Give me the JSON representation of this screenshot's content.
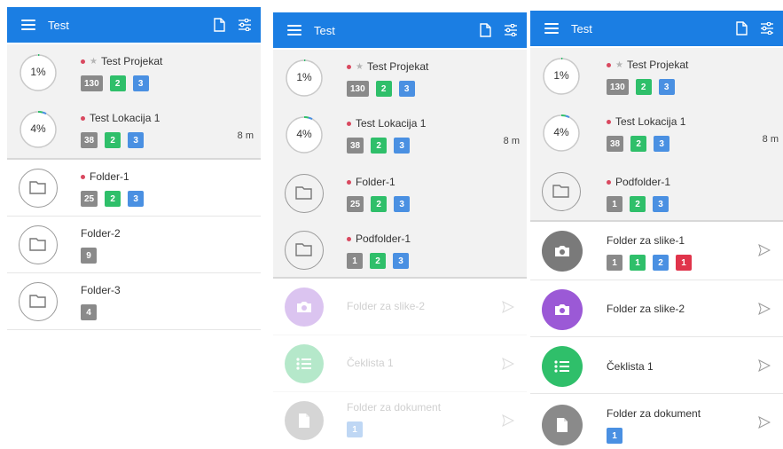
{
  "app": {
    "title": "Test"
  },
  "panels": [
    {
      "projects": [
        {
          "percent": "1%",
          "name": "Test Projekat",
          "starred": true,
          "badges": [
            "130",
            "2",
            "3"
          ]
        },
        {
          "percent": "4%",
          "name": "Test Lokacija 1",
          "badges": [
            "38",
            "2",
            "3"
          ],
          "time": "8 m"
        }
      ],
      "folders": [
        {
          "name": "Folder-1",
          "dot": true,
          "badges": [
            "25",
            "2",
            "3"
          ]
        },
        {
          "name": "Folder-2",
          "badges": [
            "9"
          ]
        },
        {
          "name": "Folder-3",
          "badges": [
            "4"
          ]
        }
      ]
    },
    {
      "projects": [
        {
          "percent": "1%",
          "name": "Test Projekat",
          "starred": true,
          "badges": [
            "130",
            "2",
            "3"
          ]
        },
        {
          "percent": "4%",
          "name": "Test Lokacija 1",
          "badges": [
            "38",
            "2",
            "3"
          ],
          "time": "8 m"
        }
      ],
      "folders": [
        {
          "name": "Folder-1",
          "dot": true,
          "badges": [
            "25",
            "2",
            "3"
          ]
        },
        {
          "name": "Podfolder-1",
          "dot": true,
          "badges": [
            "1",
            "2",
            "3"
          ]
        }
      ],
      "items": [
        {
          "name": "Folder za slike-2",
          "icon": "camera-icon",
          "color": "#9b59d6"
        },
        {
          "name": "Čeklista 1",
          "icon": "checklist-icon",
          "color": "#2fbf6a"
        },
        {
          "name": "Folder za dokument",
          "icon": "document-icon",
          "color": "#8a8a8a",
          "badges": [
            "1"
          ]
        }
      ]
    },
    {
      "projects": [
        {
          "percent": "1%",
          "name": "Test Projekat",
          "starred": true,
          "badges": [
            "130",
            "2",
            "3"
          ]
        },
        {
          "percent": "4%",
          "name": "Test Lokacija 1",
          "badges": [
            "38",
            "2",
            "3"
          ],
          "time": "8 m"
        }
      ],
      "folders": [
        {
          "name": "Podfolder-1",
          "dot": true,
          "badges": [
            "1",
            "2",
            "3"
          ]
        }
      ],
      "items": [
        {
          "name": "Folder za slike-1",
          "icon": "camera-icon",
          "color": "#7a7a7a",
          "badges": [
            "1",
            "1",
            "2",
            "1"
          ]
        },
        {
          "name": "Folder za slike-2",
          "icon": "camera-icon",
          "color": "#9b59d6"
        },
        {
          "name": "Čeklista 1",
          "icon": "checklist-icon",
          "color": "#2fbf6a"
        },
        {
          "name": "Folder za dokument",
          "icon": "document-icon",
          "color": "#8a8a8a",
          "badges": [
            "1"
          ]
        }
      ]
    }
  ],
  "colors": {
    "appbar": "#1b7ee3",
    "green": "#2fbf6a",
    "blue": "#4a90e2",
    "gray": "#8a8a8a",
    "red": "#e0344b",
    "dot": "#d9485f"
  }
}
